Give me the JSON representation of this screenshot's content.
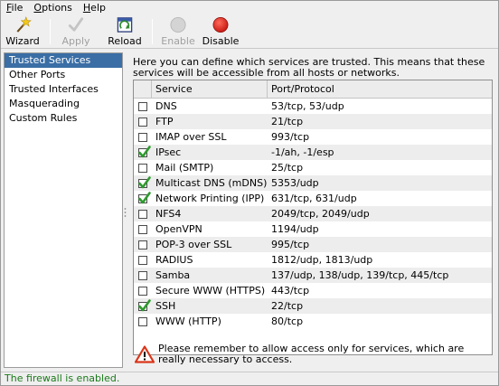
{
  "menubar": {
    "items": [
      {
        "label": "File",
        "mnemonic": "F",
        "rest": "ile"
      },
      {
        "label": "Options",
        "mnemonic": "O",
        "rest": "ptions"
      },
      {
        "label": "Help",
        "mnemonic": "H",
        "rest": "elp"
      }
    ]
  },
  "toolbar": {
    "wizard": "Wizard",
    "apply": "Apply",
    "reload": "Reload",
    "enable": "Enable",
    "disable": "Disable"
  },
  "sidebar": {
    "items": [
      {
        "label": "Trusted Services",
        "selected": true
      },
      {
        "label": "Other Ports",
        "selected": false
      },
      {
        "label": "Trusted Interfaces",
        "selected": false
      },
      {
        "label": "Masquerading",
        "selected": false
      },
      {
        "label": "Custom Rules",
        "selected": false
      }
    ]
  },
  "main": {
    "intro": "Here you can define which services are trusted. This means that these services will be accessible from all hosts or networks.",
    "columns": {
      "service": "Service",
      "port": "Port/Protocol"
    },
    "rows": [
      {
        "service": "DNS",
        "port": "53/tcp, 53/udp",
        "checked": false
      },
      {
        "service": "FTP",
        "port": "21/tcp",
        "checked": false
      },
      {
        "service": "IMAP over SSL",
        "port": "993/tcp",
        "checked": false
      },
      {
        "service": "IPsec",
        "port": "-1/ah, -1/esp",
        "checked": true
      },
      {
        "service": "Mail (SMTP)",
        "port": "25/tcp",
        "checked": false
      },
      {
        "service": "Multicast DNS (mDNS)",
        "port": "5353/udp",
        "checked": true
      },
      {
        "service": "Network Printing (IPP)",
        "port": "631/tcp, 631/udp",
        "checked": true
      },
      {
        "service": "NFS4",
        "port": "2049/tcp, 2049/udp",
        "checked": false
      },
      {
        "service": "OpenVPN",
        "port": "1194/udp",
        "checked": false
      },
      {
        "service": "POP-3 over SSL",
        "port": "995/tcp",
        "checked": false
      },
      {
        "service": "RADIUS",
        "port": "1812/udp, 1813/udp",
        "checked": false
      },
      {
        "service": "Samba",
        "port": "137/udp, 138/udp, 139/tcp, 445/tcp",
        "checked": false
      },
      {
        "service": "Secure WWW (HTTPS)",
        "port": "443/tcp",
        "checked": false
      },
      {
        "service": "SSH",
        "port": "22/tcp",
        "checked": true
      },
      {
        "service": "WWW (HTTP)",
        "port": "80/tcp",
        "checked": false
      }
    ],
    "warning": "Please remember to allow access only for services, which are really necessary to access."
  },
  "statusbar": {
    "text": "The firewall is enabled.",
    "color": "#1a7a1a"
  },
  "colors": {
    "selection": "#3a6ea5",
    "check": "#2e9a2e",
    "disable_red": "#d9211a"
  },
  "icons": {
    "wizard": "magic-wand-icon",
    "apply": "checkmark-icon",
    "reload": "reload-icon",
    "enable": "gray-circle-icon",
    "disable": "red-circle-icon",
    "warning": "warning-triangle-icon"
  }
}
